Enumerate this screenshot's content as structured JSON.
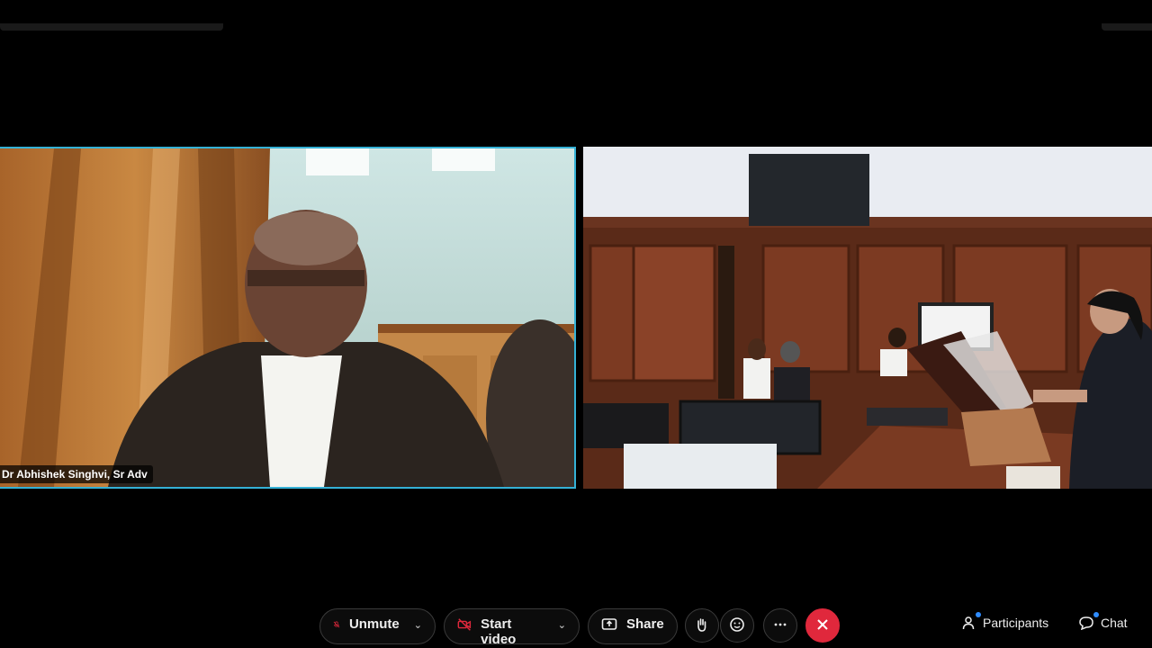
{
  "meeting": {
    "tiles": [
      {
        "name": "Dr Abhishek Singhvi, Sr Adv",
        "active_speaker": true
      },
      {
        "name": "",
        "active_speaker": false
      }
    ]
  },
  "toolbar": {
    "unmute_label": "Unmute",
    "start_video_label": "Start video",
    "share_label": "Share",
    "participants_label": "Participants",
    "chat_label": "Chat"
  },
  "colors": {
    "active_speaker_border": "#34b1d6",
    "end_call": "#e0283c",
    "notification_dot": "#2f8cff"
  },
  "icons": {
    "unmute": "muted-mic-icon",
    "start_video": "video-off-icon",
    "share": "share-screen-icon",
    "raise_hand": "hand-icon",
    "reactions": "emoji-icon",
    "more": "more-icon",
    "end": "end-call-icon",
    "participants": "person-icon",
    "chat": "chat-bubble-icon"
  }
}
